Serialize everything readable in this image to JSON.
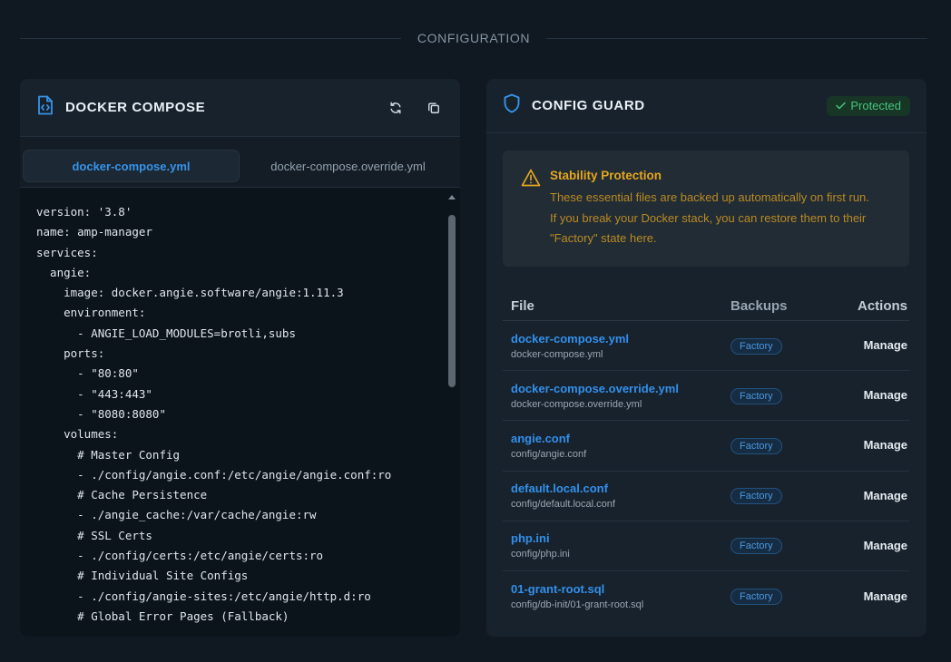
{
  "section": {
    "title": "CONFIGURATION"
  },
  "docker_compose": {
    "title": "DOCKER COMPOSE",
    "icons": {
      "file": "file-code-icon",
      "refresh": "refresh-icon",
      "copy": "copy-icon"
    },
    "tabs": [
      {
        "label": "docker-compose.yml",
        "active": true
      },
      {
        "label": "docker-compose.override.yml",
        "active": false
      }
    ],
    "code_lines": [
      "version: '3.8'",
      "name: amp-manager",
      "services:",
      "  angie:",
      "    image: docker.angie.software/angie:1.11.3",
      "    environment:",
      "      - ANGIE_LOAD_MODULES=brotli,subs",
      "    ports:",
      "      - \"80:80\"",
      "      - \"443:443\"",
      "      - \"8080:8080\"",
      "    volumes:",
      "      # Master Config",
      "      - ./config/angie.conf:/etc/angie/angie.conf:ro",
      "      # Cache Persistence",
      "      - ./angie_cache:/var/cache/angie:rw",
      "      # SSL Certs",
      "      - ./config/certs:/etc/angie/certs:ro",
      "      # Individual Site Configs",
      "      - ./config/angie-sites:/etc/angie/http.d:ro",
      "      # Global Error Pages (Fallback)"
    ]
  },
  "config_guard": {
    "title": "CONFIG GUARD",
    "status": "Protected",
    "icons": {
      "shield": "shield-icon",
      "check": "check-icon",
      "warning": "warning-icon"
    },
    "alert": {
      "title": "Stability Protection",
      "text": "These essential files are backed up automatically on first run. If you break your Docker stack, you can restore them to their \"Factory\" state here."
    },
    "table": {
      "headers": {
        "file": "File",
        "backups": "Backups",
        "actions": "Actions"
      },
      "rows": [
        {
          "name": "docker-compose.yml",
          "path": "docker-compose.yml",
          "backup": "Factory",
          "action": "Manage"
        },
        {
          "name": "docker-compose.override.yml",
          "path": "docker-compose.override.yml",
          "backup": "Factory",
          "action": "Manage"
        },
        {
          "name": "angie.conf",
          "path": "config/angie.conf",
          "backup": "Factory",
          "action": "Manage"
        },
        {
          "name": "default.local.conf",
          "path": "config/default.local.conf",
          "backup": "Factory",
          "action": "Manage"
        },
        {
          "name": "php.ini",
          "path": "config/php.ini",
          "backup": "Factory",
          "action": "Manage"
        },
        {
          "name": "01-grant-root.sql",
          "path": "config/db-init/01-grant-root.sql",
          "backup": "Factory",
          "action": "Manage"
        }
      ]
    }
  }
}
